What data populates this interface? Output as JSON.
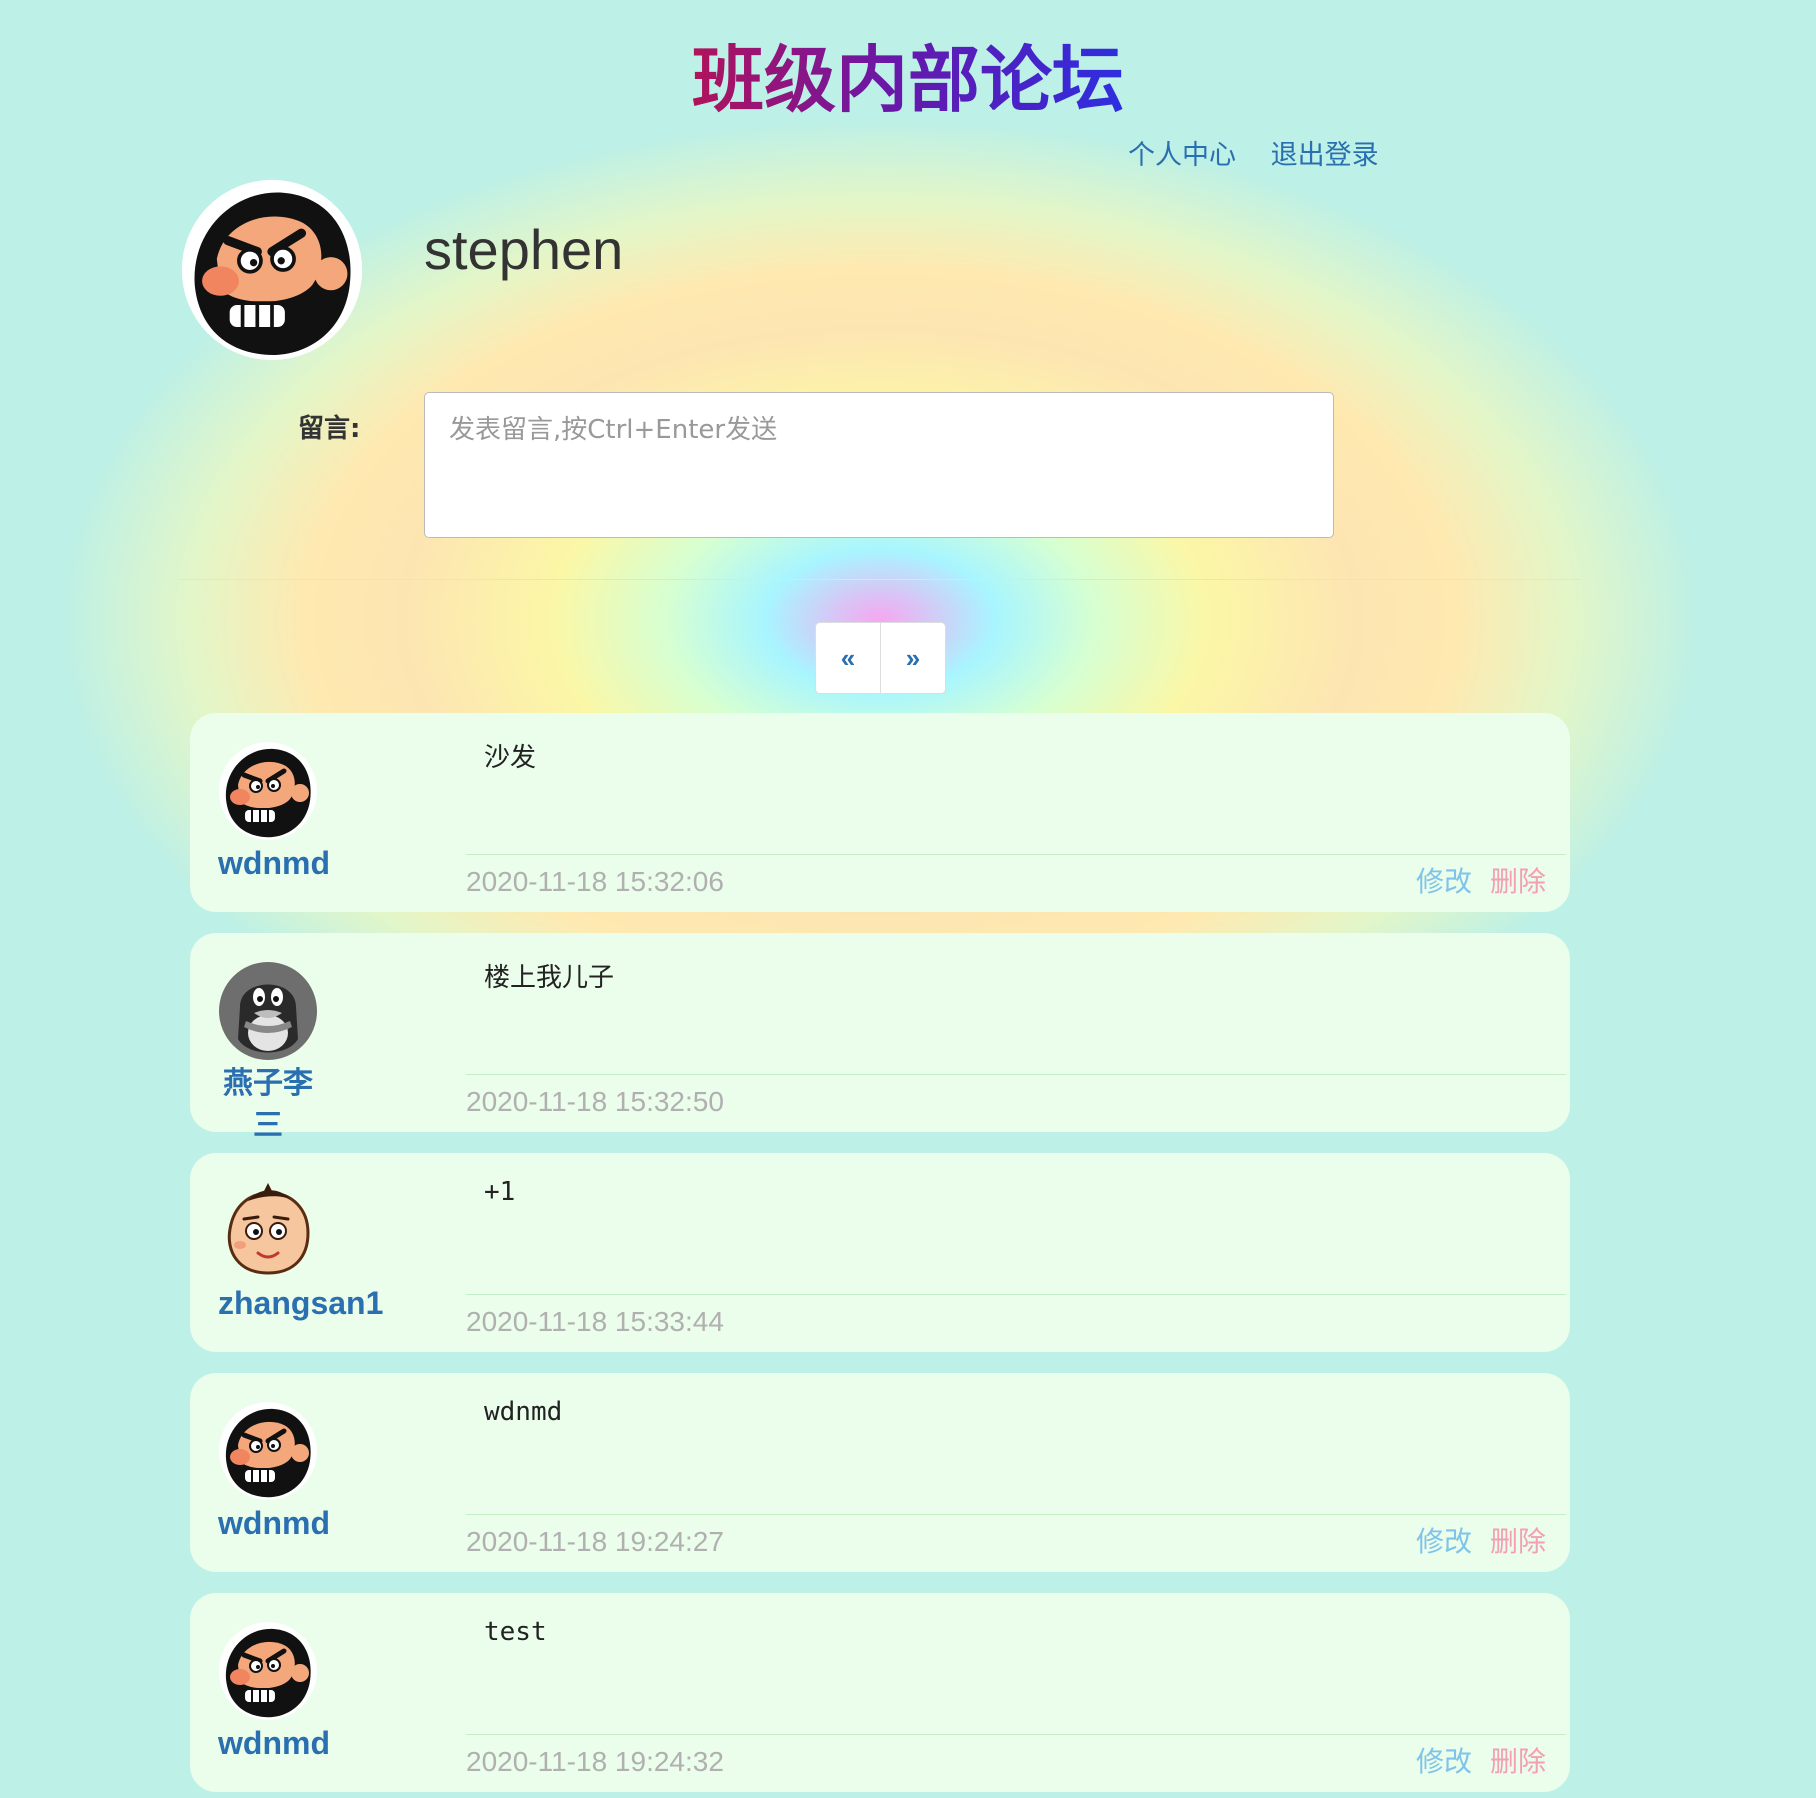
{
  "header": {
    "title": "班级内部论坛",
    "links": [
      "个人中心",
      "退出登录"
    ]
  },
  "user": {
    "username": "stephen",
    "avatar": "angry-bearded-man-avatar"
  },
  "comment_form": {
    "label": "留言:",
    "placeholder": "发表留言,按Ctrl+Enter发送"
  },
  "pagination": {
    "prev": "«",
    "next": "»"
  },
  "posts": [
    {
      "author": "wdnmd",
      "avatar": "angry-bearded-man-avatar",
      "content": "沙发",
      "time": "2020-11-18 15:32:06",
      "edit": "修改",
      "delete": "删除"
    },
    {
      "author": "燕子李三",
      "avatar": "penguin-avatar",
      "content": "楼上我儿子",
      "time": "2020-11-18 15:32:50",
      "edit": "",
      "delete": ""
    },
    {
      "author": "zhangsan1",
      "avatar": "cartoon-boy-avatar",
      "content": "+1",
      "time": "2020-11-18 15:33:44",
      "edit": "",
      "delete": ""
    },
    {
      "author": "wdnmd",
      "avatar": "angry-bearded-man-avatar",
      "content": "wdnmd",
      "time": "2020-11-18 19:24:27",
      "edit": "修改",
      "delete": "删除"
    },
    {
      "author": "wdnmd",
      "avatar": "angry-bearded-man-avatar",
      "content": "test",
      "time": "2020-11-18 19:24:32",
      "edit": "修改",
      "delete": "删除"
    }
  ],
  "colors": {
    "link": "#2a6fb0",
    "edit": "#7ec4ea",
    "delete": "#f3a0b5",
    "card": "#ebfdeb",
    "timestamp": "#b0b0b0"
  }
}
